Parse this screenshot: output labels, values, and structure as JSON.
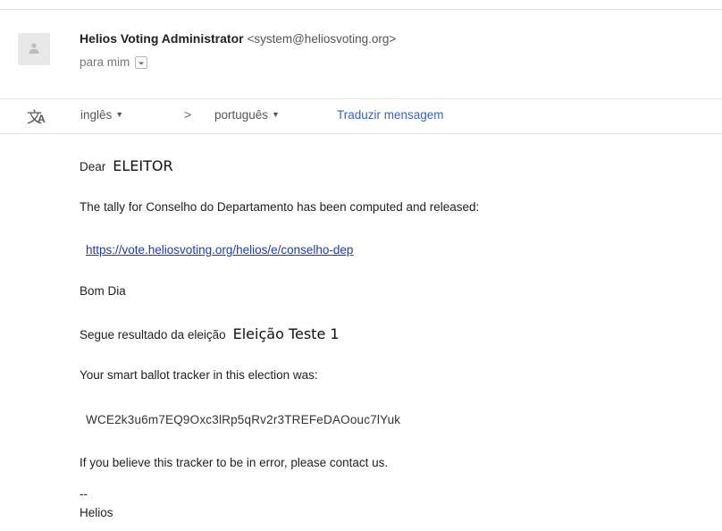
{
  "header": {
    "avatar_icon": "person-icon",
    "sender_name": "Helios Voting Administrator",
    "sender_email": "<system@heliosvoting.org>",
    "to_label": "para mim",
    "details_toggle_icon": "chevron-down-icon"
  },
  "translate": {
    "icon": "translate-icon",
    "icon_big": "文",
    "icon_small": "A",
    "from_language": "inglês",
    "separator": ">",
    "to_language": "português",
    "caret": "▼",
    "action_label": "Traduzir mensagem"
  },
  "message": {
    "greeting": "Dear",
    "voter_name": "ELEITOR",
    "tally_line": "The tally for Conselho do Departamento has been computed and released:",
    "election_url": "https://vote.heliosvoting.org/helios/e/conselho-dep",
    "good_day": "Bom Dia",
    "result_prefix": "Segue resultado da eleição",
    "election_name": "Eleição Teste 1",
    "tracker_intro": "Your smart ballot tracker in this election was:",
    "tracker_value": "WCE2k3u6m7EQ9Oxc3lRp5qRv2r3TREFeDAOouc7lYuk",
    "error_note": "If you believe this tracker to be in error, please contact us.",
    "signature_separator": "--",
    "signature": "Helios"
  },
  "colors": {
    "link": "#1a3bb3",
    "translate_link": "#3b63b8",
    "avatar_bg": "#e8e8e8"
  }
}
